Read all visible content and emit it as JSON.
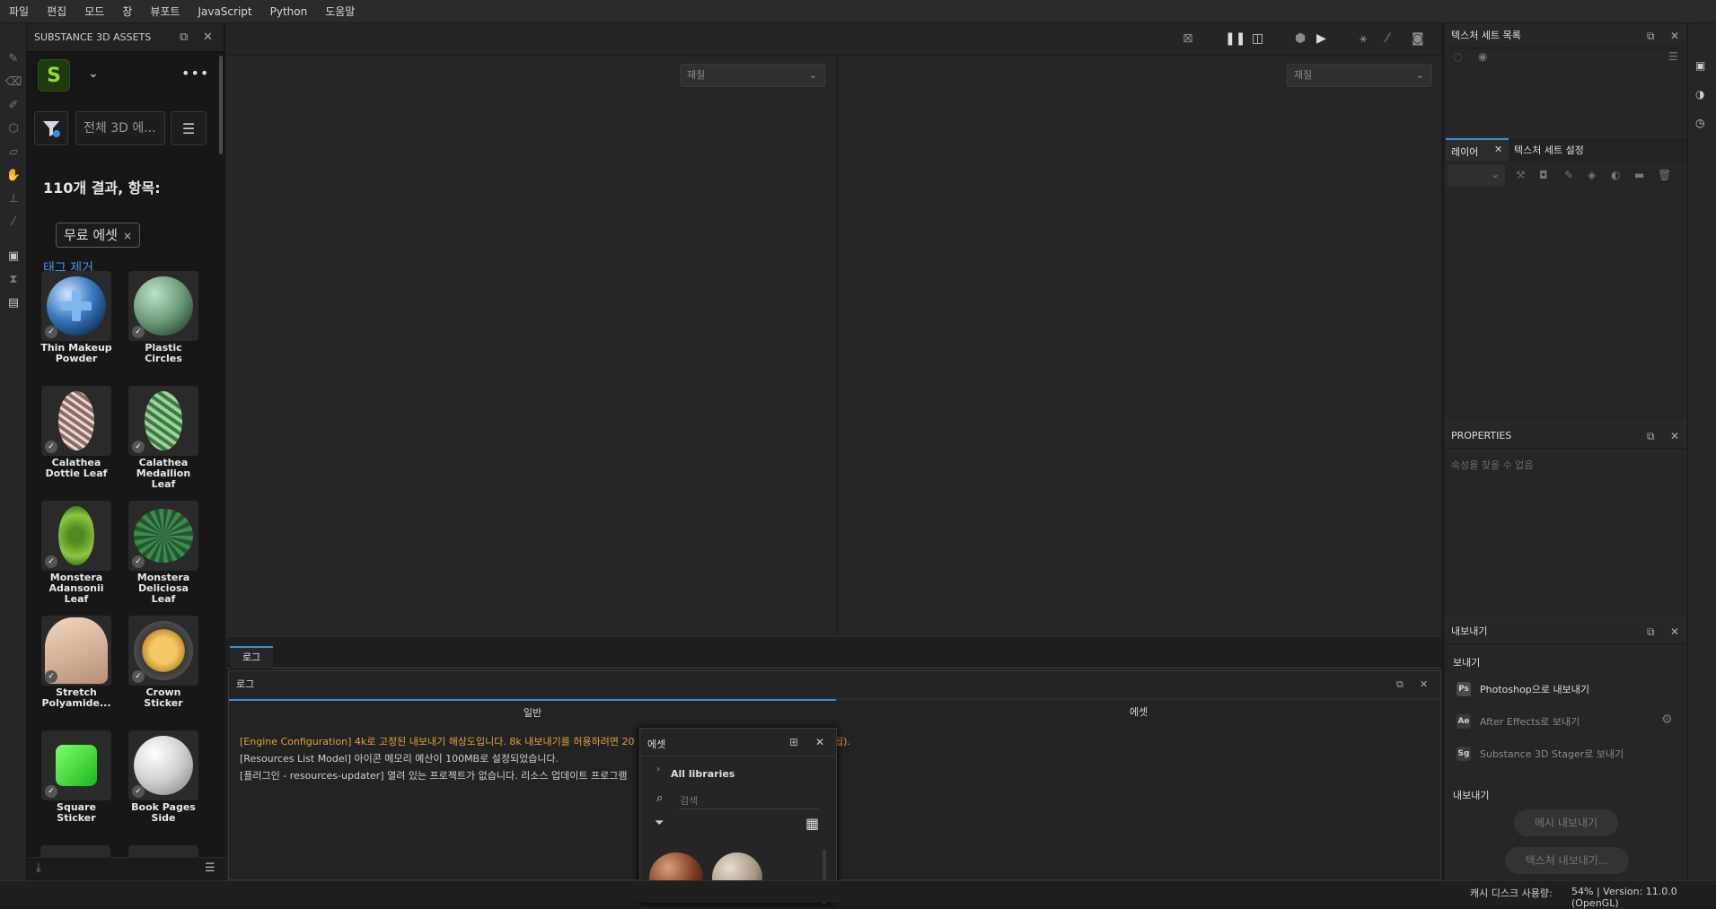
{
  "menu": [
    "파일",
    "편집",
    "모드",
    "창",
    "뷰포트",
    "JavaScript",
    "Python",
    "도움말"
  ],
  "assets_panel": {
    "title": "SUBSTANCE 3D ASSETS",
    "logo_letter": "S",
    "search_placeholder": "전체 3D 에...",
    "results_text": "110개 결과, 항목:",
    "tag_label": "무료 에셋",
    "tag_close": "×",
    "clear_tags": "태그 제거",
    "items": [
      {
        "name": "Thin Makeup Powder"
      },
      {
        "name": "Plastic Circles"
      },
      {
        "name": "Calathea Dottie Leaf"
      },
      {
        "name": "Calathea Medallion Leaf"
      },
      {
        "name": "Monstera Adansonii Leaf"
      },
      {
        "name": "Monstera Deliciosa Leaf"
      },
      {
        "name": "Stretch Polyamide..."
      },
      {
        "name": "Crown Sticker"
      },
      {
        "name": "Square Sticker"
      },
      {
        "name": "Book Pages Side"
      }
    ]
  },
  "viewport": {
    "material_left": "재질",
    "material_right": "재질"
  },
  "log_dock": {
    "tab": "로그",
    "panel_title": "로그",
    "col_general": "일반",
    "col_preset": "에셋",
    "lines": [
      {
        "text": "[Engine Configuration] 4k로 고정된 내보내기 해상도입니다. 8k 내보내기를 허용하려면 20",
        "color": "#e0a23a"
      },
      {
        "text": "[Resources List Model] 아이콘 메모리 예산이 100MB로 설정되었습니다.",
        "color": "#cfcfcf"
      },
      {
        "text": "[플러그인 - resources-updater] 열려 있는 프로젝트가 없습니다. 리소스 업데이트 프로그램",
        "color": "#cfcfcf"
      }
    ],
    "line1_tail": "됩)."
  },
  "preset_panel": {
    "title": "에셋",
    "libraries": "All libraries",
    "search_placeholder": "검색"
  },
  "texture_set_list": {
    "title": "텍스처 세트 목록"
  },
  "layers": {
    "tab_layers": "레이어",
    "tab_settings": "텍스처 세트 설정"
  },
  "properties": {
    "title": "PROPERTIES",
    "empty": "속성을 찾을 수 없음"
  },
  "export": {
    "title": "내보내기",
    "send_heading": "보내기",
    "send_photoshop": "Photoshop으로 내보내기",
    "send_ae": "After Effects로 보내기",
    "send_stager": "Substance 3D Stager로 보내기",
    "export_heading": "내보내기",
    "mesh_btn": "메시 내보내기",
    "texture_btn": "텍스처 내보내기..."
  },
  "status": {
    "cache": "캐시 디스크 사용량:",
    "info": "54% | Version: 11.0.0 (OpenGL)"
  },
  "colors": {
    "accent": "#3b8fd9",
    "brand_green": "#8fdc2f",
    "warning": "#e0a23a"
  }
}
